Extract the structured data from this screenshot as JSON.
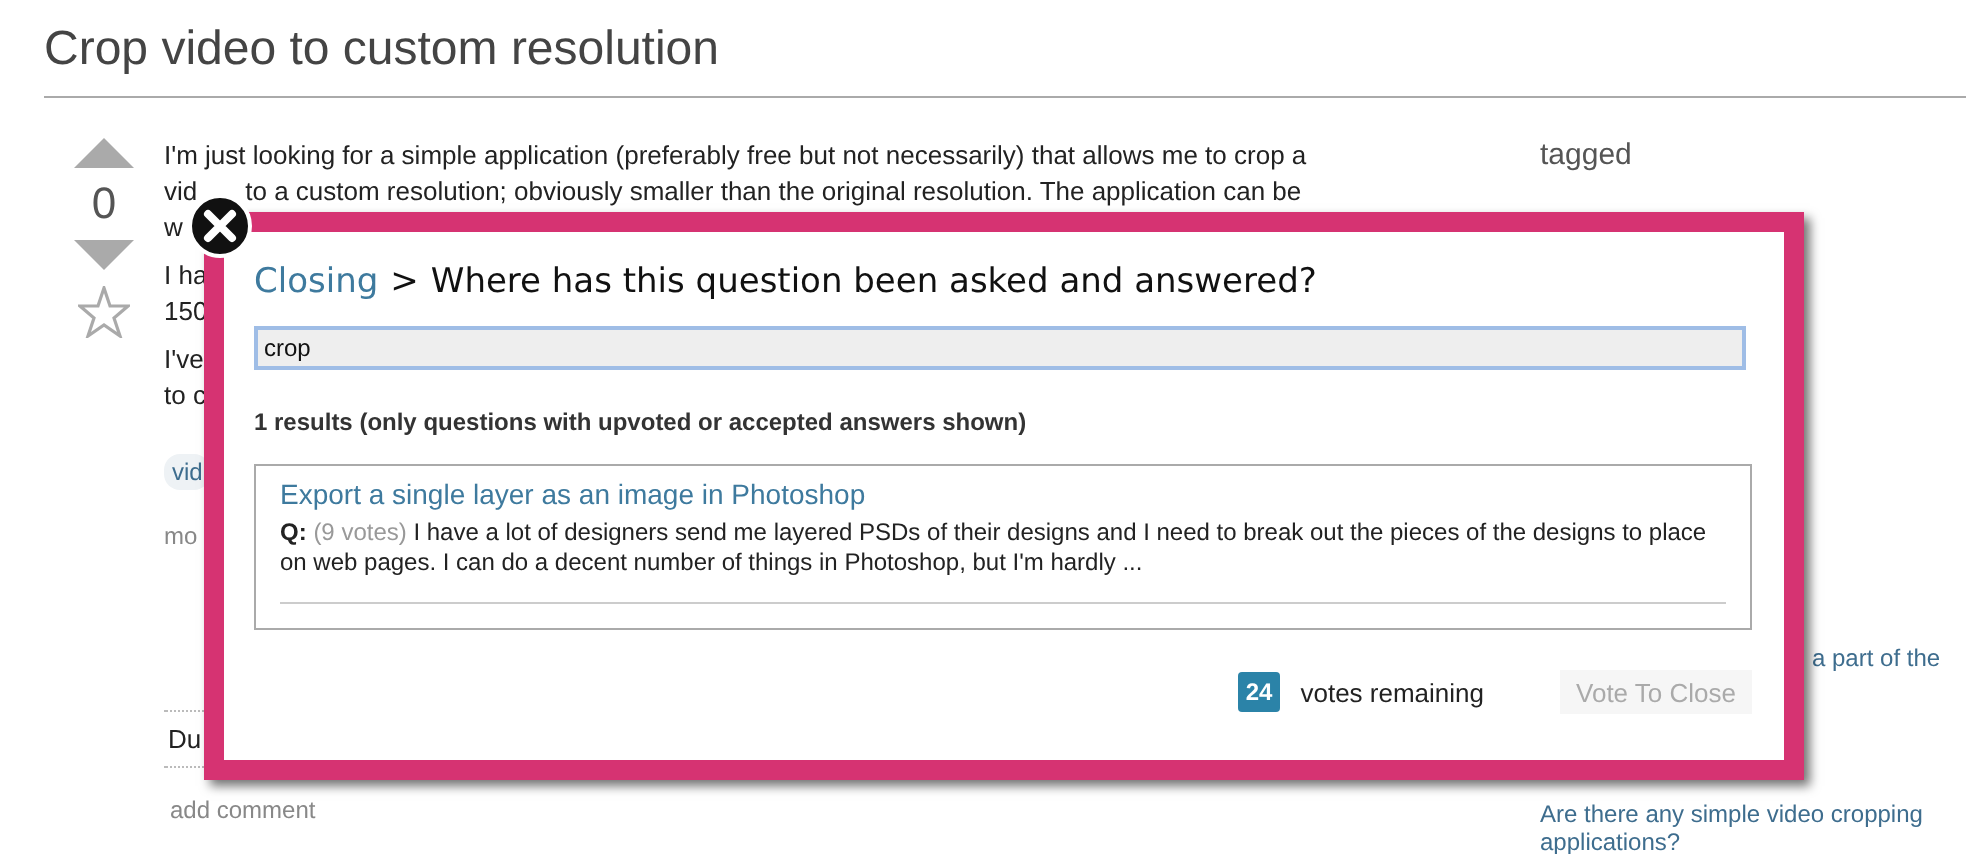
{
  "page": {
    "title": "Crop video to custom resolution"
  },
  "question": {
    "votes": "0",
    "favorite": false,
    "paragraphs": [
      [
        "I'm just looking for a simple application (preferably free but not necessarily) that allows me to crop a",
        [
          "vid",
          "to a custom resolution; obviously smaller than the original resolution. The application can be"
        ],
        "w"
      ],
      [
        "I ha",
        "150"
      ],
      [
        "I've",
        "to c"
      ]
    ],
    "tag": "vid",
    "more": "mo",
    "duplicate_note": "Du",
    "add_comment": "add comment"
  },
  "sidebar": {
    "heading": "tagged",
    "link_fragment": "a part of the",
    "related_link": "Are there any simple video cropping applications?"
  },
  "dialog": {
    "breadcrumb": "Closing",
    "separator": ">",
    "title": "Where has this question been asked and answered?",
    "search": {
      "value": "crop"
    },
    "results_summary": "1 results (only questions with upvoted or accepted answers shown)",
    "results": [
      {
        "title": "Export a single layer as an image in Photoshop",
        "prefix": "Q:",
        "votes": "(9 votes)",
        "excerpt": "I have a lot of designers send me layered PSDs of their designs and I need to break out the pieces of the designs to place on web pages. I can do a decent number of things in Photoshop, but I'm hardly ..."
      }
    ],
    "votes_remaining": {
      "count": "24",
      "label": "votes remaining"
    },
    "submit": {
      "label": "Vote To Close",
      "disabled": true
    }
  }
}
